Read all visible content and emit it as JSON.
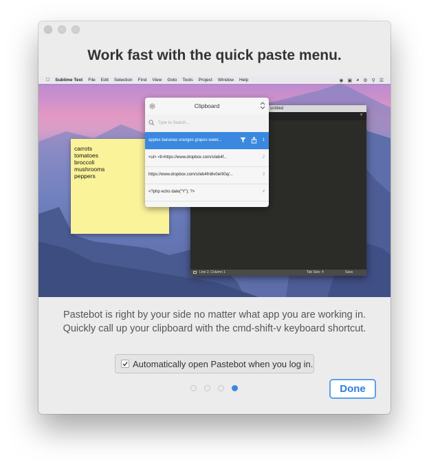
{
  "window": {
    "title": "Work fast with the quick paste menu.",
    "description": "Pastebot is right by your side no matter what app you are working in. Quickly call up your clipboard with the cmd-shift-v keyboard shortcut.",
    "checkbox_label": "Automatically open Pastebot when you log in.",
    "checkbox_checked": true,
    "done_label": "Done",
    "page_count": 4,
    "current_page": 4
  },
  "screenshot": {
    "menubar": {
      "app_name": "Sublime Text",
      "items": [
        "File",
        "Edit",
        "Selection",
        "Find",
        "View",
        "Goto",
        "Tools",
        "Project",
        "Window",
        "Help"
      ]
    },
    "sticky_note": {
      "lines": [
        "carrots",
        "tomatoes",
        "broccoli",
        "mushrooms",
        "peppers"
      ]
    },
    "editor": {
      "title": "untitled",
      "status_position": "Line 2, Column 1",
      "tab_size": "Tab Size: 4",
      "syntax": "Sass"
    },
    "clipboard_popup": {
      "title": "Clipboard",
      "search_placeholder": "Type to Search...",
      "rows": [
        {
          "text": "apples bananas oranges grapes water...",
          "num": "1",
          "selected": true
        },
        {
          "text": "<ul>      <li>https://www.dropbox.com/s/ieb4f...",
          "num": "2",
          "selected": false
        },
        {
          "text": "https://www.dropbox.com/s/ieb4fni8v0er90q/...",
          "num": "3",
          "selected": false
        },
        {
          "text": "<?php echo date(\"Y\"); ?>",
          "num": "4",
          "selected": false
        }
      ]
    }
  },
  "colors": {
    "accent": "#3b88e0",
    "sticky": "#fbf39a",
    "editor_bg": "#2b2b27"
  }
}
